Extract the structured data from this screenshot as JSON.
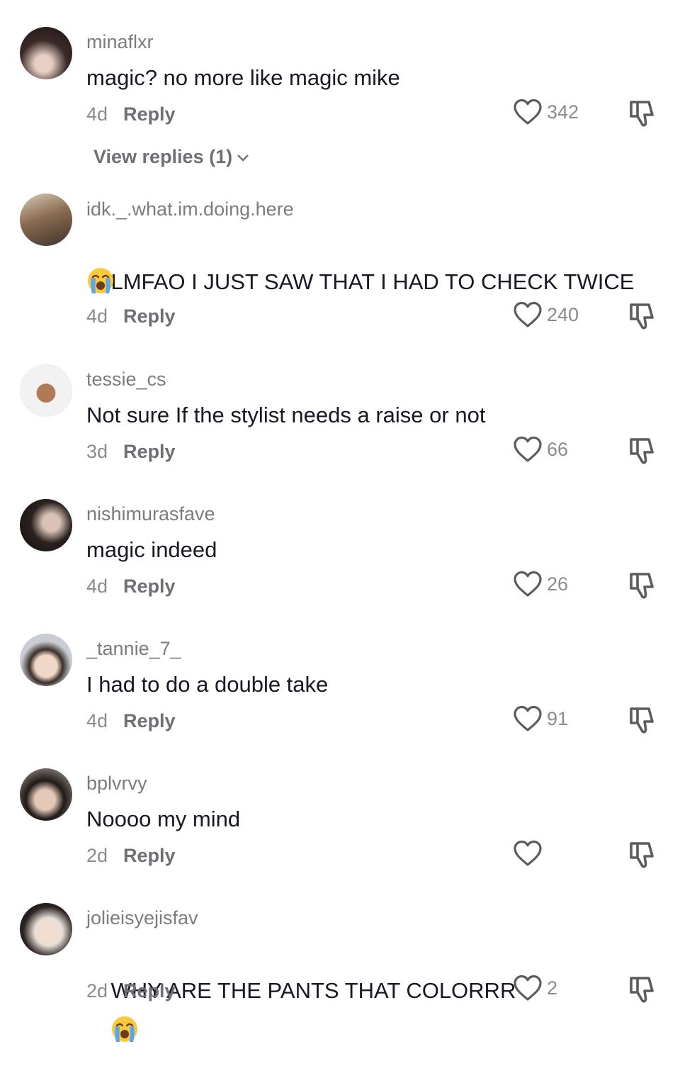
{
  "comments": [
    {
      "username": "minaflxr",
      "text": "magic? no more like magic mike",
      "time": "4d",
      "reply": "Reply",
      "likes": "342"
    },
    {
      "username": "idk._.what.im.doing.here",
      "text": "LMFAO I JUST SAW THAT I HAD TO CHECK TWICE",
      "time": "4d",
      "reply": "Reply",
      "likes": "240"
    },
    {
      "username": "tessie_cs",
      "text": "Not sure If the stylist needs a raise or not",
      "time": "3d",
      "reply": "Reply",
      "likes": "66"
    },
    {
      "username": "nishimurasfave",
      "text": "magic indeed",
      "time": "4d",
      "reply": "Reply",
      "likes": "26"
    },
    {
      "username": "_tannie_7_",
      "text": "I had to do a double take",
      "time": "4d",
      "reply": "Reply",
      "likes": "91"
    },
    {
      "username": "bplvrvy",
      "text": "Noooo my mind",
      "time": "2d",
      "reply": "Reply",
      "likes": ""
    },
    {
      "username": "jolieisyejisfav",
      "text": "WHY ARE THE PANTS THAT COLORRR",
      "time": "2d",
      "reply": "Reply",
      "likes": "2"
    }
  ],
  "view_replies": "View replies (1)",
  "icons": {
    "like": "heart-outline-icon",
    "dislike": "thumbs-down-outline-icon",
    "emoji": "loudly-crying-face-emoji",
    "chevron": "chevron-down-icon"
  },
  "colors": {
    "username": "#7c7c7c",
    "text": "#161823",
    "meta": "#8a8b91",
    "icon": "#5b5c61"
  }
}
